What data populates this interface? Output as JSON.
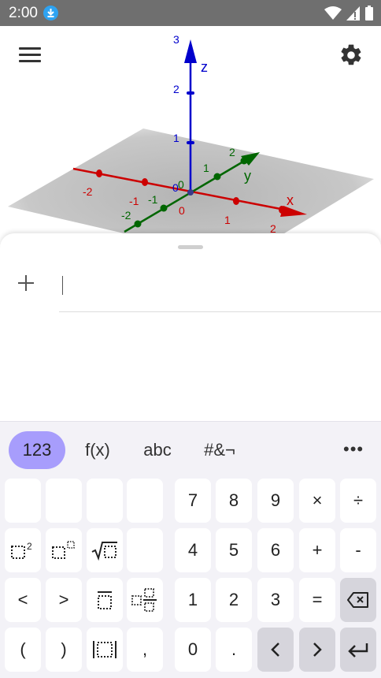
{
  "status_bar": {
    "time": "2:00"
  },
  "graphics": {
    "axis_labels": {
      "x": "x",
      "y": "y",
      "z": "z"
    },
    "z_ticks": [
      "1",
      "2",
      "3"
    ],
    "y_ticks": [
      "-2",
      "-1",
      "1",
      "2"
    ],
    "x_ticks": [
      "-2",
      "-1",
      "1",
      "2"
    ],
    "origin_labels": [
      "0",
      "0",
      "0"
    ]
  },
  "keyboard": {
    "tabs": [
      "123",
      "f(x)",
      "abc",
      "#&¬"
    ],
    "more": "•••",
    "keys": {
      "seven": "7",
      "eight": "8",
      "nine": "9",
      "times": "×",
      "divide": "÷",
      "four": "4",
      "five": "5",
      "six": "6",
      "plus": "+",
      "minus": "-",
      "less": "<",
      "greater": ">",
      "one": "1",
      "two": "2",
      "three": "3",
      "equals": "=",
      "lparen": "(",
      "rparen": ")",
      "comma": ",",
      "zero": "0",
      "dot": "."
    }
  },
  "colors": {
    "x_axis": "#cc0000",
    "y_axis": "#006600",
    "z_axis": "#0000cc",
    "active_tab": "#a79dfc",
    "keyboard_bg": "#f3f2f7"
  }
}
